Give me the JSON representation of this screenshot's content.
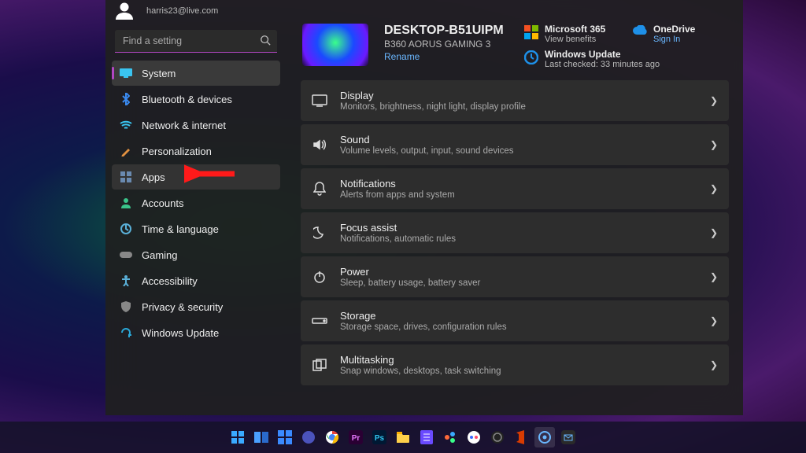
{
  "user": {
    "email": "harris23@live.com"
  },
  "search": {
    "placeholder": "Find a setting"
  },
  "sidebar": {
    "items": [
      {
        "label": "System",
        "icon": "monitor-icon"
      },
      {
        "label": "Bluetooth & devices",
        "icon": "bluetooth-icon"
      },
      {
        "label": "Network & internet",
        "icon": "wifi-icon"
      },
      {
        "label": "Personalization",
        "icon": "brush-icon"
      },
      {
        "label": "Apps",
        "icon": "grid-icon"
      },
      {
        "label": "Accounts",
        "icon": "person-icon"
      },
      {
        "label": "Time & language",
        "icon": "clock-globe-icon"
      },
      {
        "label": "Gaming",
        "icon": "gamepad-icon"
      },
      {
        "label": "Accessibility",
        "icon": "accessibility-icon"
      },
      {
        "label": "Privacy & security",
        "icon": "shield-icon"
      },
      {
        "label": "Windows Update",
        "icon": "update-icon"
      }
    ],
    "selected_index": 0,
    "hover_index": 4
  },
  "device": {
    "name": "DESKTOP-B51UIPM",
    "sub": "B360 AORUS GAMING 3",
    "rename": "Rename"
  },
  "promo": {
    "ms365": {
      "title": "Microsoft 365",
      "sub": "View benefits"
    },
    "onedrive": {
      "title": "OneDrive",
      "sub": "Sign In"
    },
    "update": {
      "title": "Windows Update",
      "sub": "Last checked: 33 minutes ago"
    }
  },
  "settings": [
    {
      "title": "Display",
      "sub": "Monitors, brightness, night light, display profile",
      "icon": "display-icon"
    },
    {
      "title": "Sound",
      "sub": "Volume levels, output, input, sound devices",
      "icon": "sound-icon"
    },
    {
      "title": "Notifications",
      "sub": "Alerts from apps and system",
      "icon": "bell-icon"
    },
    {
      "title": "Focus assist",
      "sub": "Notifications, automatic rules",
      "icon": "moon-icon"
    },
    {
      "title": "Power",
      "sub": "Sleep, battery usage, battery saver",
      "icon": "power-icon"
    },
    {
      "title": "Storage",
      "sub": "Storage space, drives, configuration rules",
      "icon": "drive-icon"
    },
    {
      "title": "Multitasking",
      "sub": "Snap windows, desktops, task switching",
      "icon": "multitask-icon"
    }
  ],
  "taskbar": {
    "items": [
      "start-icon",
      "task-view-icon",
      "widgets-icon",
      "teams-icon",
      "chrome-icon",
      "premiere-icon",
      "photoshop-icon",
      "explorer-icon",
      "notes-icon",
      "vscode-icon",
      "discord-icon",
      "obs-icon",
      "office-icon",
      "settings-icon",
      "mail-icon"
    ],
    "active_index": 13
  },
  "arrow_color": "#ff1a1a"
}
